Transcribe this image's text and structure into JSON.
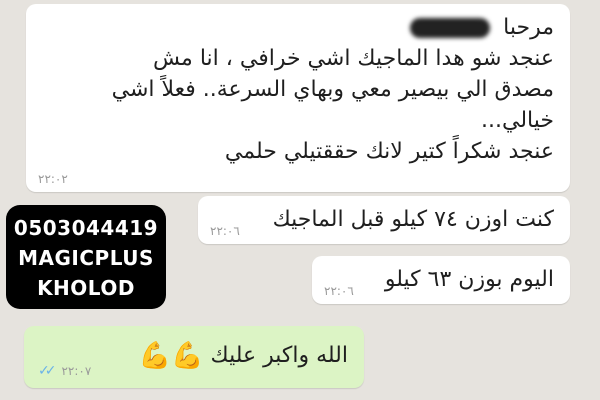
{
  "messages": [
    {
      "lines": [
        "مرحبا",
        "عنجد شو هدا الماجيك اشي خرافي ، انا مش",
        "مصدق الي بيصير معي وبهاي السرعة.. فعلاً اشي",
        "خيالي...",
        "عنجد شكراً كتير لانك حققتيلي حلمي"
      ],
      "time": "٢٢:٠٢"
    },
    {
      "text": "كنت اوزن ٧٤ كيلو قبل الماجيك",
      "time": "٢٢:٠٦"
    },
    {
      "text": "اليوم بوزن ٦٣ كيلو",
      "time": "٢٢:٠٦"
    },
    {
      "text": "الله واكبر عليك",
      "emoji": "💪💪",
      "time": "٢٢:٠٧",
      "read_receipt": "✓✓"
    }
  ],
  "overlay": {
    "lines": [
      "0503044419",
      "MAGICPLUS",
      "KHOLOD"
    ]
  },
  "colors": {
    "background": "#e6e3de",
    "incoming": "#ffffff",
    "outgoing": "#dcf4c5",
    "overlay": "#000000"
  }
}
